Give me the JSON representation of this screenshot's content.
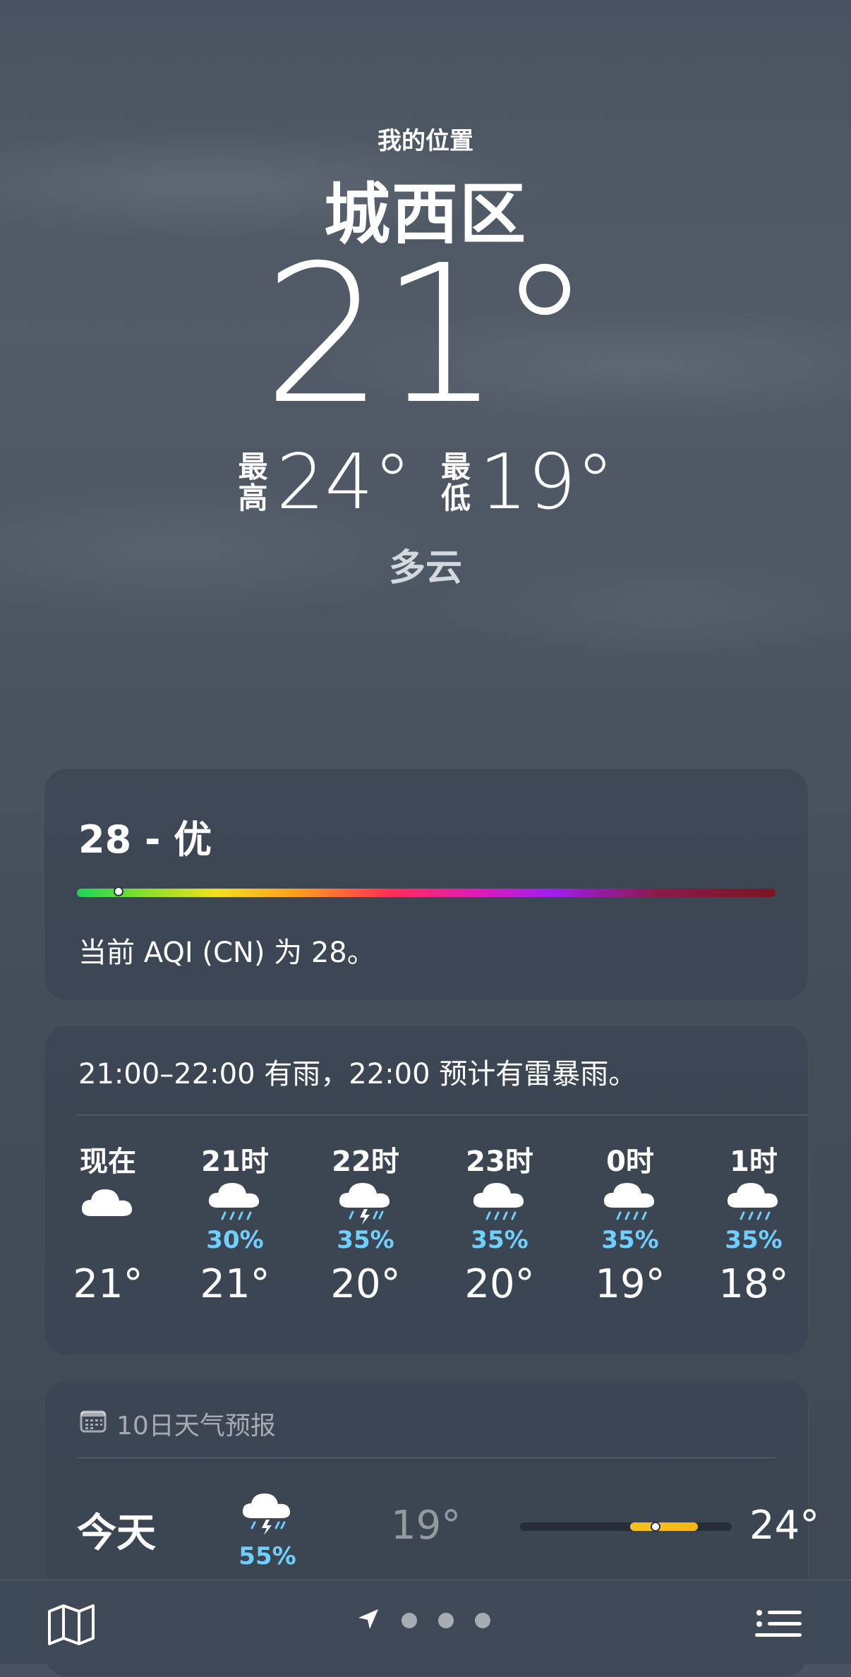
{
  "header": {
    "location_label": "我的位置",
    "city": "城西区",
    "temperature": "21°",
    "high_label": "最\n高",
    "high_value": "24°",
    "low_label": "最\n低",
    "low_value": "19°",
    "condition": "多云"
  },
  "aqi": {
    "value_text": "28 - 优",
    "indicator_fraction": 0.06,
    "description": "当前 AQI (CN) 为 28。"
  },
  "hourly": {
    "summary": "21:00–22:00 有雨，22:00 预计有雷暴雨。",
    "hours": [
      {
        "time": "现在",
        "icon": "cloud-icon",
        "precip": "",
        "temp": "21°"
      },
      {
        "time": "21时",
        "icon": "cloud-rain-icon",
        "precip": "30%",
        "temp": "21°"
      },
      {
        "time": "22时",
        "icon": "cloud-bolt-rain-icon",
        "precip": "35%",
        "temp": "20°"
      },
      {
        "time": "23时",
        "icon": "cloud-rain-icon",
        "precip": "35%",
        "temp": "20°"
      },
      {
        "time": "0时",
        "icon": "cloud-rain-icon",
        "precip": "35%",
        "temp": "19°"
      },
      {
        "time": "1时",
        "icon": "cloud-rain-icon",
        "precip": "35%",
        "temp": "18°"
      }
    ]
  },
  "forecast": {
    "title": "10日天气预报",
    "icon": "calendar-icon",
    "days": [
      {
        "day": "今天",
        "icon": "cloud-bolt-rain-icon",
        "precip": "55%",
        "low": "19°",
        "high": "24°",
        "range_start": 0.52,
        "range_end": 0.84,
        "current": 0.64
      }
    ]
  },
  "bottombar": {
    "map_icon": "map-icon",
    "location_icon": "location-arrow-icon",
    "page_dots": 3,
    "list_icon": "list-icon"
  },
  "colors": {
    "precip_blue": "#6fd0ff",
    "range_yellow": "#f3c21b"
  }
}
